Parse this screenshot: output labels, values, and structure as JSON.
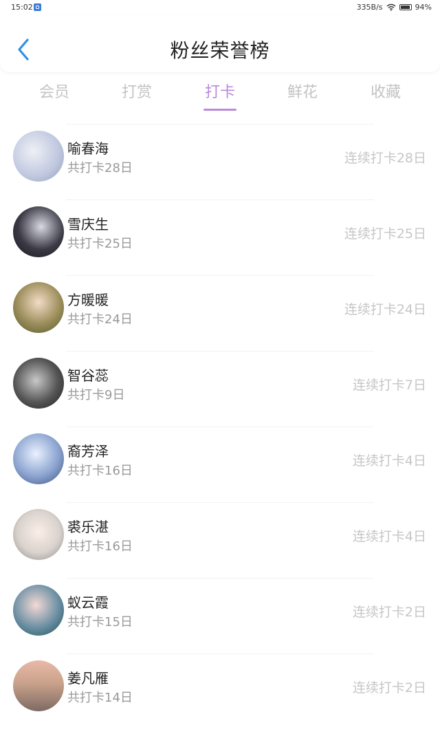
{
  "status_bar": {
    "time": "15:02",
    "network_speed": "335B/s",
    "battery": "94%",
    "icons": [
      "app-notification-icon",
      "wifi-icon",
      "battery-icon"
    ]
  },
  "header": {
    "title": "粉丝荣誉榜",
    "back_icon": "chevron-left-icon",
    "accent_color": "#2f8ee6"
  },
  "tabs": {
    "items": [
      {
        "label": "会员"
      },
      {
        "label": "打赏"
      },
      {
        "label": "打卡"
      },
      {
        "label": "鲜花"
      },
      {
        "label": "收藏"
      }
    ],
    "active_index": 2,
    "active_color": "#b98ad9"
  },
  "list": {
    "items": [
      {
        "name": "喻春海",
        "total": "共打卡28日",
        "streak": "连续打卡28日",
        "avatar_color": "#bfc7df"
      },
      {
        "name": "雪庆生",
        "total": "共打卡25日",
        "streak": "连续打卡25日",
        "avatar_color": "#3b3a45"
      },
      {
        "name": "方暖暖",
        "total": "共打卡24日",
        "streak": "连续打卡24日",
        "avatar_color": "#9c8d5a"
      },
      {
        "name": "智谷蕊",
        "total": "共打卡9日",
        "streak": "连续打卡7日",
        "avatar_color": "#555555"
      },
      {
        "name": "裔芳泽",
        "total": "共打卡16日",
        "streak": "连续打卡4日",
        "avatar_color": "#8aa3cf"
      },
      {
        "name": "裘乐湛",
        "total": "共打卡16日",
        "streak": "连续打卡4日",
        "avatar_color": "#d9d2cd"
      },
      {
        "name": "蚁云霞",
        "total": "共打卡15日",
        "streak": "连续打卡2日",
        "avatar_color": "#6b8fa4"
      },
      {
        "name": "姜凡雁",
        "total": "共打卡14日",
        "streak": "连续打卡2日",
        "avatar_color": "#c9a28a"
      }
    ]
  }
}
